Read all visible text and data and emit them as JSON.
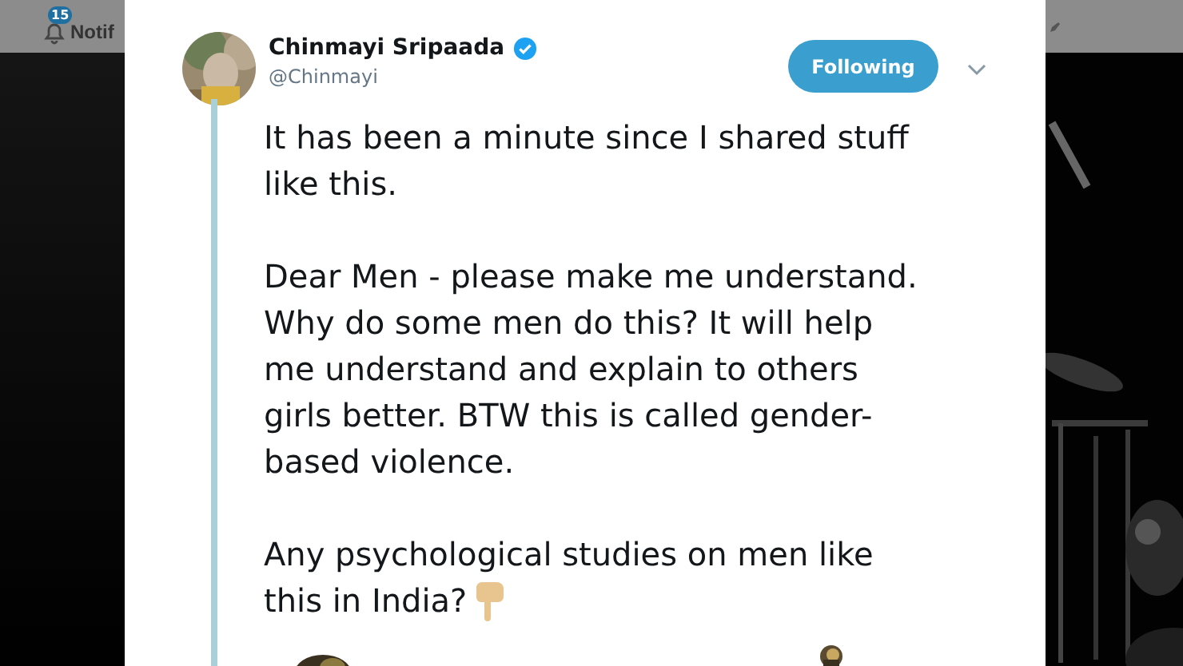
{
  "nav": {
    "badge": "15",
    "label": "Notif"
  },
  "tweet": {
    "name": "Chinmayi Sripaada",
    "verified": true,
    "handle": "@Chinmayi",
    "follow_button": "Following",
    "paragraphs": [
      [
        "It has been a minute since I shared stuff",
        "like this."
      ],
      [
        "Dear Men - please make me understand.",
        "Why do some men do this? It will help",
        "me understand and explain to others",
        "girls better. BTW this is called gender-",
        "based violence."
      ],
      [
        "Any psychological studies on men like",
        "this in India?"
      ]
    ]
  }
}
